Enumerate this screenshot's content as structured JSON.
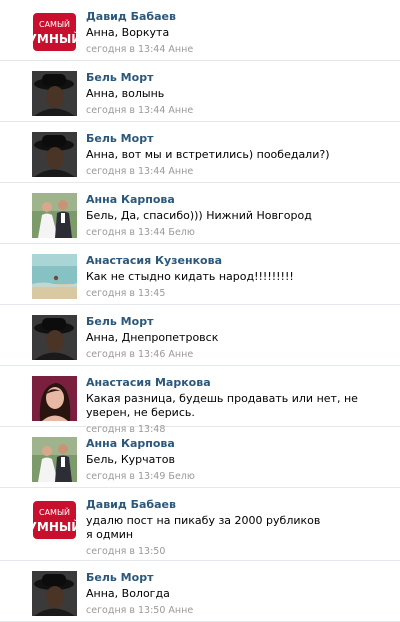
{
  "comments": [
    {
      "author": "Давид Бабаев",
      "avatar": "show-logo-avatar",
      "text": "Анна, Воркута",
      "time": "сегодня в 13:44",
      "reply_to": "Анне"
    },
    {
      "author": "Бель Морт",
      "avatar": "hat-portrait-avatar",
      "text": "Анна, волынь",
      "time": "сегодня в 13:44",
      "reply_to": "Анне"
    },
    {
      "author": "Бель Морт",
      "avatar": "hat-portrait-avatar",
      "text": "Анна, вот мы и встретились) пообедали?)",
      "time": "сегодня в 13:44",
      "reply_to": "Анне"
    },
    {
      "author": "Анна Карпова",
      "avatar": "wedding-photo-avatar",
      "text": "Бель, Да, спасибо))) Нижний Новгород",
      "time": "сегодня в 13:44",
      "reply_to": "Белю"
    },
    {
      "author": "Анастасия Кузенкова",
      "avatar": "beach-photo-avatar",
      "text": "Как не стыдно кидать народ!!!!!!!!!",
      "time": "сегодня в 13:45",
      "reply_to": ""
    },
    {
      "author": "Бель Морт",
      "avatar": "hat-portrait-avatar",
      "text": "Анна, Днепропетровск",
      "time": "сегодня в 13:46",
      "reply_to": "Анне"
    },
    {
      "author": "Анастасия Маркова",
      "avatar": "woman-portrait-avatar",
      "text": "Какая разница, будешь продавать или нет, не уверен, не берись.",
      "time": "сегодня в 13:48",
      "reply_to": ""
    },
    {
      "author": "Анна Карпова",
      "avatar": "wedding-photo-avatar",
      "text": "Бель, Курчатов",
      "time": "сегодня в 13:49",
      "reply_to": "Белю"
    },
    {
      "author": "Давид Бабаев",
      "avatar": "show-logo-avatar",
      "text": "удалю пост на пикабу за 2000 рубликов\nя одмин",
      "time": "сегодня в 13:50",
      "reply_to": ""
    },
    {
      "author": "Бель Морт",
      "avatar": "hat-portrait-avatar",
      "text": "Анна, Вологда",
      "time": "сегодня в 13:50",
      "reply_to": "Анне"
    }
  ],
  "logo": {
    "line1": "САМЫЙ",
    "line2": "УМНЫЙ"
  },
  "colors": {
    "author": "#2b587a",
    "meta": "#999999",
    "divider": "#e4e8ed"
  }
}
